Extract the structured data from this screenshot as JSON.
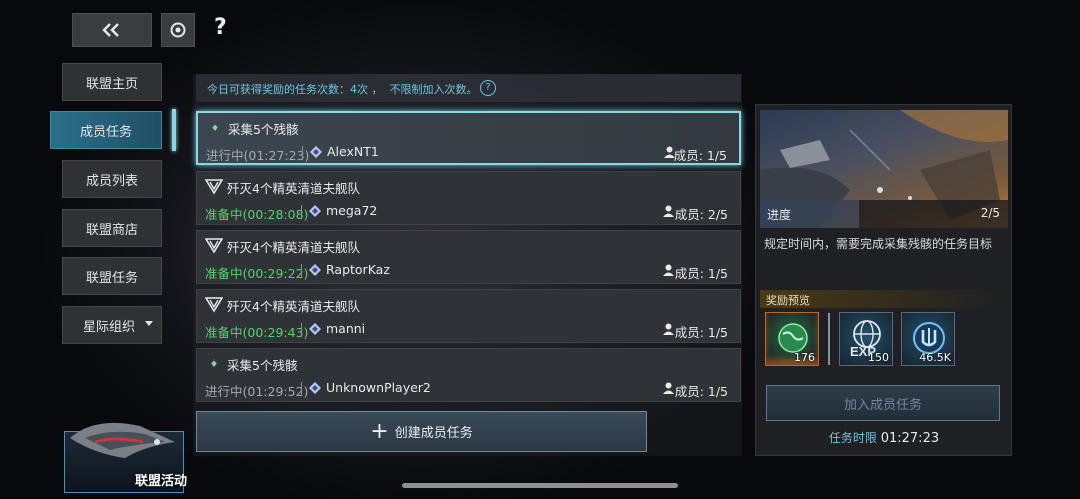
{
  "top": {
    "help": "?"
  },
  "sidebar": {
    "items": [
      {
        "label": "联盟主页"
      },
      {
        "label": "成员任务"
      },
      {
        "label": "成员列表"
      },
      {
        "label": "联盟商店"
      },
      {
        "label": "联盟任务"
      },
      {
        "label": "星际组织"
      }
    ]
  },
  "bottom_left": {
    "label": "联盟活动"
  },
  "info_bar": {
    "text": "今日可获得奖励的任务次数：4次 ，  不限制加入次数。",
    "help": "?"
  },
  "tasks": [
    {
      "title": "采集5个残骸",
      "status": "进行中(01:27:23)",
      "player": "AlexNT1",
      "members": "成员: 1/5"
    },
    {
      "title": "歼灭4个精英清道夫舰队",
      "status": "准备中(00:28:08)",
      "player": "mega72",
      "members": "成员: 2/5"
    },
    {
      "title": "歼灭4个精英清道夫舰队",
      "status": "准备中(00:29:22)",
      "player": "RaptorKaz",
      "members": "成员: 1/5"
    },
    {
      "title": "歼灭4个精英清道夫舰队",
      "status": "准备中(00:29:43)",
      "player": "manni",
      "members": "成员: 1/5"
    },
    {
      "title": "采集5个残骸",
      "status": "进行中(01:29:52)",
      "player": "UnknownPlayer2",
      "members": "成员: 1/5"
    }
  ],
  "create_button": {
    "plus": "+",
    "label": "创建成员任务"
  },
  "detail": {
    "progress_label": "进度",
    "progress_value": "2/5",
    "progress_fraction": 0.4,
    "description": "规定时间内，需要完成采集残骸的任务目标",
    "reward_title": "奖励预览",
    "rewards": [
      {
        "icon": "globe-icon",
        "amount": "176"
      },
      {
        "icon": "exp-icon",
        "amount": "150"
      },
      {
        "icon": "credit-icon",
        "amount": "46.5K"
      }
    ],
    "join_button": "加入成员任务",
    "time_limit_label": "任务时限",
    "time_limit_value": "01:27:23"
  },
  "colors": {
    "accent": "#8ed6e6",
    "ready_green": "#57d36a",
    "sidebar_active": "#2c6f8a"
  }
}
